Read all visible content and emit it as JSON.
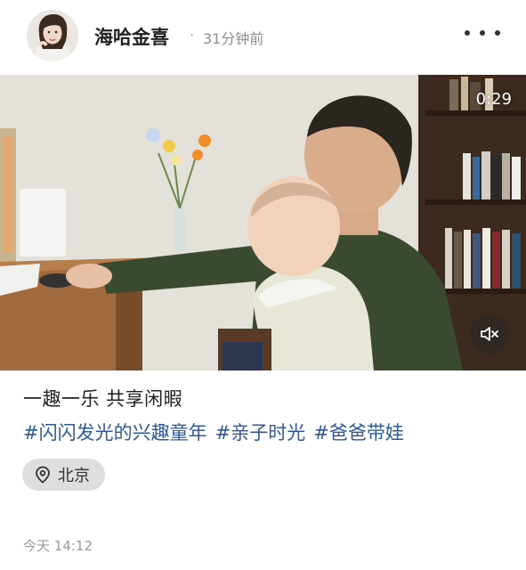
{
  "header": {
    "author": "海哈金喜",
    "separator": "·",
    "time_ago": "31分钟前",
    "more_icon": "more-dots-icon"
  },
  "media": {
    "duration": "0:29",
    "mute_icon": "speaker-muted-icon"
  },
  "post": {
    "caption": "一趣一乐 共享闲暇",
    "tags": [
      "#闪闪发光的兴趣童年",
      "#亲子时光",
      "#爸爸带娃"
    ],
    "location": "北京",
    "location_icon": "location-pin-icon",
    "posted_time": "今天 14:12"
  },
  "colors": {
    "tag": "#2c5a99",
    "location_bg": "#dedede",
    "muted_text": "#999999"
  }
}
